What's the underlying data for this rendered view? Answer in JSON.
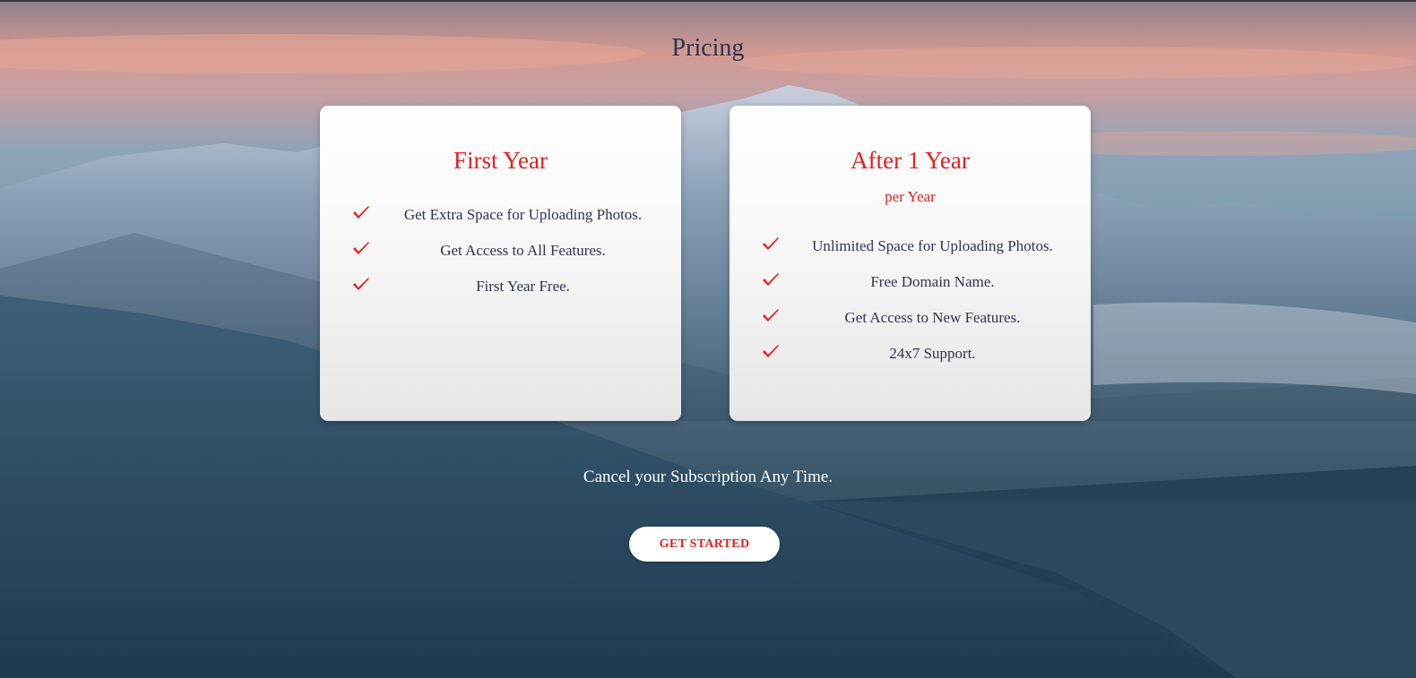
{
  "page": {
    "title": "Pricing"
  },
  "plans": [
    {
      "title": "First Year",
      "subtitle": "",
      "features": [
        "Get Extra Space for Uploading Photos.",
        "Get Access to All Features.",
        "First Year Free."
      ]
    },
    {
      "title": "After 1 Year",
      "subtitle": "per Year",
      "features": [
        "Unlimited Space for Uploading Photos.",
        "Free Domain Name.",
        "Get Access to New Features.",
        "24x7 Support."
      ]
    }
  ],
  "footer": {
    "cancel_text": "Cancel your Subscription Any Time.",
    "cta_label": "GET STARTED"
  },
  "colors": {
    "accent": "#ec1c1c",
    "text": "#2e3550",
    "card_bg": "#ffffff",
    "title": "#2c3350"
  },
  "icons": {
    "feature_icon": "check-icon"
  }
}
